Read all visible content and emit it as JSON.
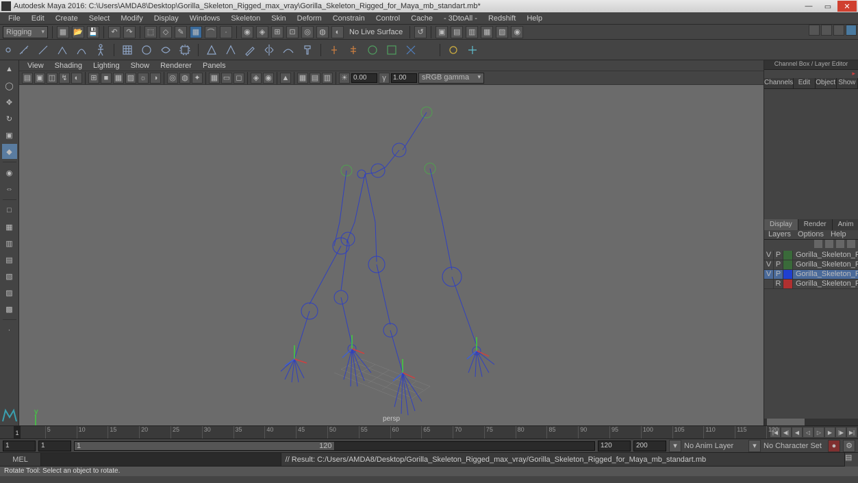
{
  "title": "Autodesk Maya 2016: C:\\Users\\AMDA8\\Desktop\\Gorilla_Skeleton_Rigged_max_vray\\Gorilla_Skeleton_Rigged_for_Maya_mb_standart.mb*",
  "menu": [
    "File",
    "Edit",
    "Create",
    "Select",
    "Modify",
    "Display",
    "Windows",
    "Skeleton",
    "Skin",
    "Deform",
    "Constrain",
    "Control",
    "Cache",
    "- 3DtoAll -",
    "Redshift",
    "Help"
  ],
  "workspace": "Rigging",
  "no_live_surface": "No Live Surface",
  "vpmenu": [
    "View",
    "Shading",
    "Lighting",
    "Show",
    "Renderer",
    "Panels"
  ],
  "exposure": "0.00",
  "gamma": "1.00",
  "colorspace": "sRGB gamma",
  "camera": "persp",
  "channelbox": {
    "title": "Channel Box / Layer Editor",
    "tabs": [
      "Channels",
      "Edit",
      "Object",
      "Show"
    ],
    "layer_tabs": [
      "Display",
      "Render",
      "Anim"
    ],
    "layer_menu": [
      "Layers",
      "Options",
      "Help"
    ],
    "layers": [
      {
        "v": "V",
        "p": "P",
        "color": "#3a6a3a",
        "name": "Gorilla_Skeleton_Rigg",
        "sel": false
      },
      {
        "v": "V",
        "p": "P",
        "color": "#3a6a3a",
        "name": "Gorilla_Skeleton_Rigg",
        "sel": false
      },
      {
        "v": "V",
        "p": "P",
        "color": "#2040d0",
        "name": "Gorilla_Skeleton_Rigg",
        "sel": true
      },
      {
        "v": "",
        "p": "R",
        "color": "#b03030",
        "name": "Gorilla_Skeleton_Rigg",
        "sel": false
      }
    ]
  },
  "timeline": {
    "start": "1",
    "end": "120",
    "range_start": "1",
    "range_end": "200",
    "cur": "1",
    "ticks": [
      "1",
      "5",
      "10",
      "15",
      "20",
      "25",
      "30",
      "35",
      "40",
      "45",
      "50",
      "55",
      "60",
      "65",
      "70",
      "75",
      "80",
      "85",
      "90",
      "95",
      "100",
      "105",
      "110",
      "115",
      "120"
    ],
    "anim_layer": "No Anim Layer",
    "char_set": "No Character Set"
  },
  "cmd": {
    "lang": "MEL",
    "result": "// Result: C:/Users/AMDA8/Desktop/Gorilla_Skeleton_Rigged_max_vray/Gorilla_Skeleton_Rigged_for_Maya_mb_standart.mb"
  },
  "help": "Rotate Tool: Select an object to rotate."
}
